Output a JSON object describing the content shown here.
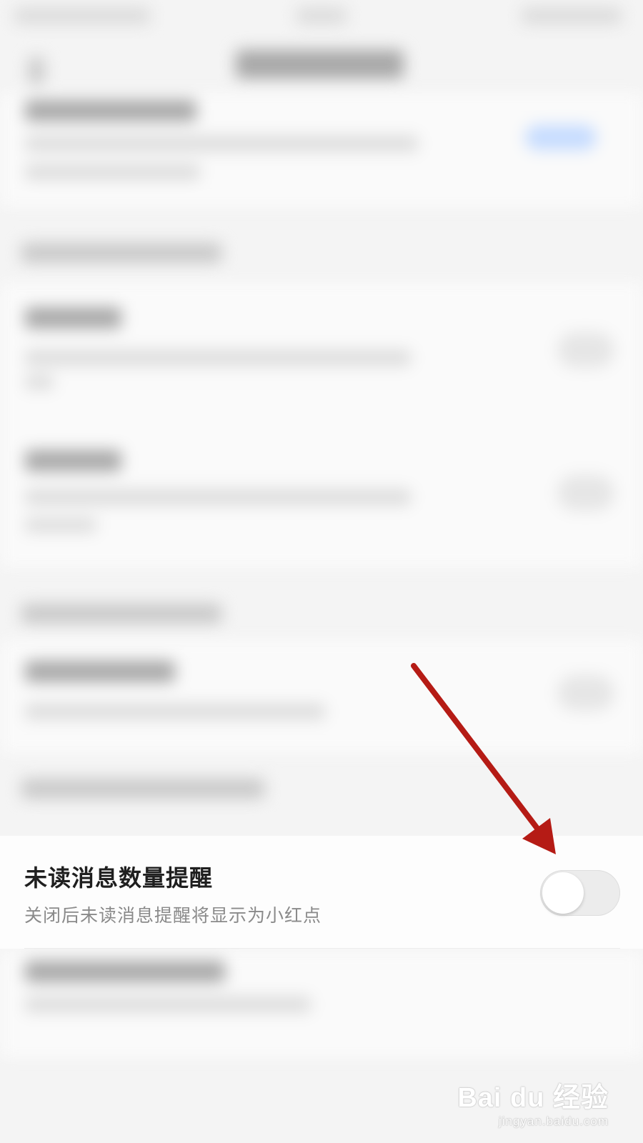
{
  "setting": {
    "title": "未读消息数量提醒",
    "subtitle": "关闭后未读消息提醒将显示为小红点",
    "toggle_on": false
  },
  "watermark": {
    "logo": "Bai du 经验",
    "url": "jingyan.baidu.com"
  },
  "colors": {
    "arrow": "#b51b15",
    "title_text": "#1f1f1f",
    "subtitle_text": "#8a8a8a",
    "toggle_track": "#ececec"
  }
}
